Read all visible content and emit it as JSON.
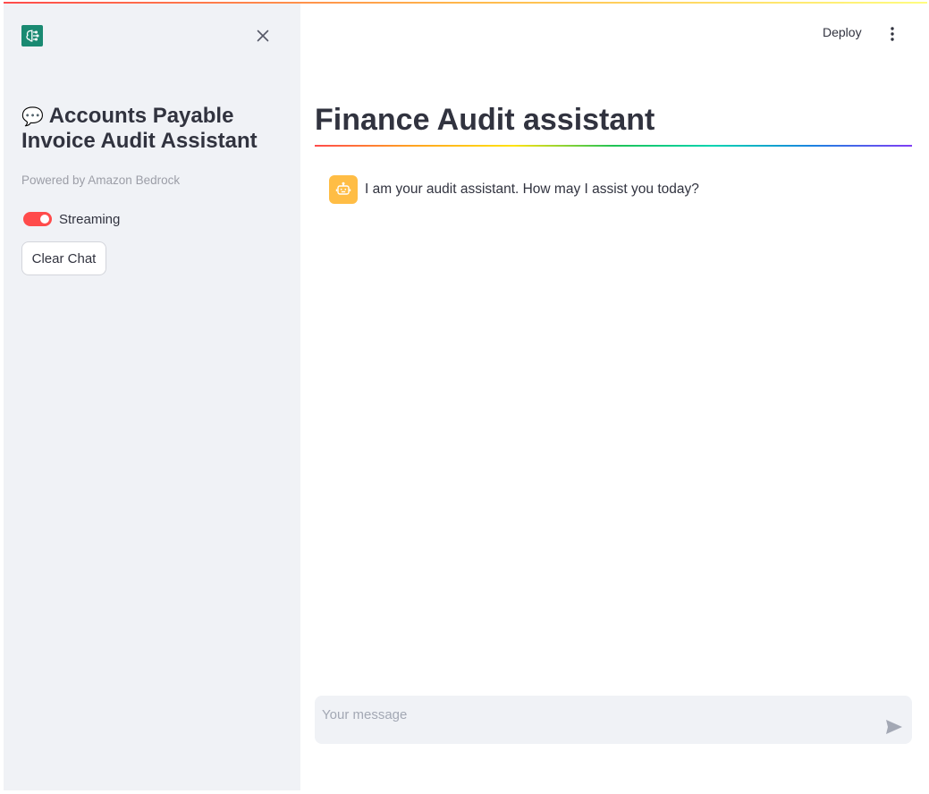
{
  "sidebar": {
    "title_emoji": "💬",
    "title": "Accounts Payable Invoice Audit Assistant",
    "caption": "Powered by Amazon Bedrock",
    "toggle": {
      "label": "Streaming",
      "on": true
    },
    "clear_button": "Clear Chat"
  },
  "header": {
    "deploy_label": "Deploy"
  },
  "main": {
    "title": "Finance Audit assistant",
    "messages": [
      {
        "role": "assistant",
        "text": "I am your audit assistant. How may I assist you today?"
      }
    ]
  },
  "chat_input": {
    "placeholder": "Your message"
  },
  "colors": {
    "accent": "#ff4b4b",
    "sidebar_bg": "#f0f2f6",
    "bot_avatar": "#ffbd45",
    "logo": "#1a8a72"
  },
  "icons": {
    "logo": "brain-chip-icon",
    "close": "close-icon",
    "menu": "kebab-menu-icon",
    "avatar": "robot-icon",
    "send": "send-icon"
  }
}
